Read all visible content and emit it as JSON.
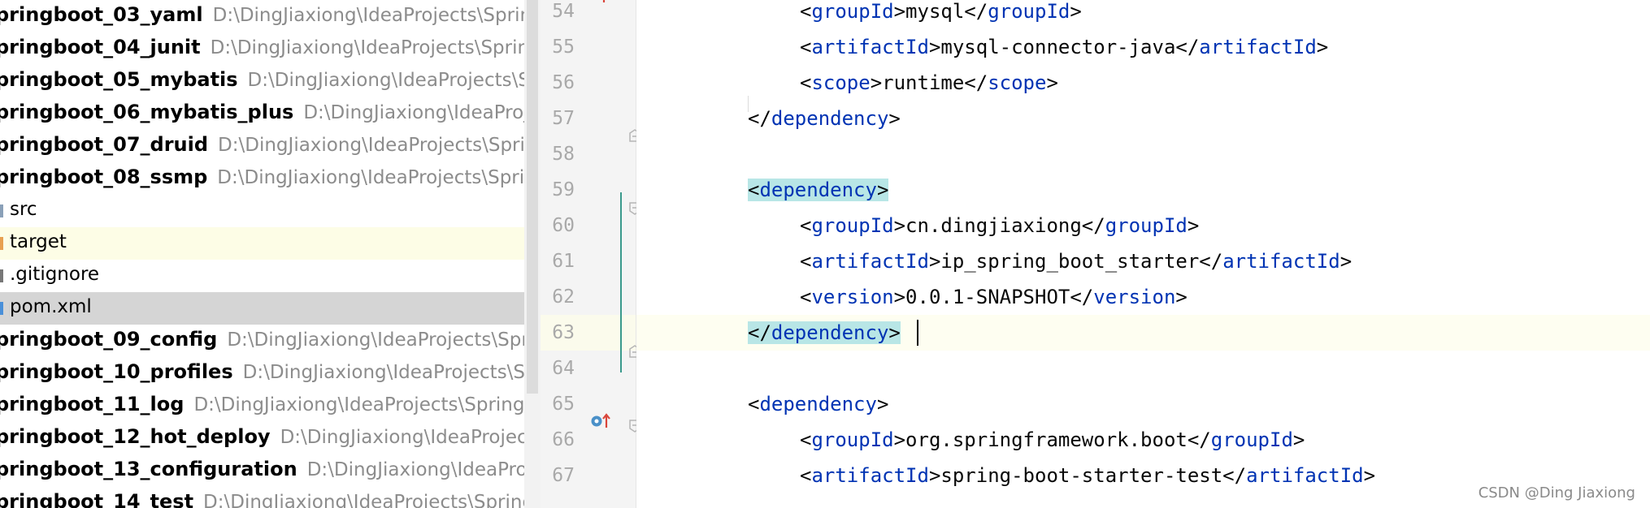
{
  "project_tree": {
    "items": [
      {
        "type": "module",
        "name": "pringboot_03_yaml",
        "path": "D:\\DingJiaxiong\\IdeaProjects\\SpringBo"
      },
      {
        "type": "module",
        "name": "pringboot_04_junit",
        "path": "D:\\DingJiaxiong\\IdeaProjects\\SpringBo"
      },
      {
        "type": "module",
        "name": "pringboot_05_mybatis",
        "path": "D:\\DingJiaxiong\\IdeaProjects\\Sprin"
      },
      {
        "type": "module",
        "name": "pringboot_06_mybatis_plus",
        "path": "D:\\DingJiaxiong\\IdeaProjects"
      },
      {
        "type": "module",
        "name": "pringboot_07_druid",
        "path": "D:\\DingJiaxiong\\IdeaProjects\\SpringB"
      },
      {
        "type": "module",
        "name": "pringboot_08_ssmp",
        "path": "D:\\DingJiaxiong\\IdeaProjects\\SpringB"
      },
      {
        "type": "folder",
        "name": "src",
        "icon": "folder-icon"
      },
      {
        "type": "folder",
        "name": "target",
        "icon": "folder-icon"
      },
      {
        "type": "file",
        "name": ".gitignore",
        "icon": "file-icon"
      },
      {
        "type": "file",
        "name": "pom.xml",
        "icon": "maven-file-icon"
      },
      {
        "type": "module",
        "name": "pringboot_09_config",
        "path": "D:\\DingJiaxiong\\IdeaProjects\\Spring"
      },
      {
        "type": "module",
        "name": "pringboot_10_profiles",
        "path": "D:\\DingJiaxiong\\IdeaProjects\\Sprin"
      },
      {
        "type": "module",
        "name": "pringboot_11_log",
        "path": "D:\\DingJiaxiong\\IdeaProjects\\SpringBo"
      },
      {
        "type": "module",
        "name": "pringboot_12_hot_deploy",
        "path": "D:\\DingJiaxiong\\IdeaProjects\\S"
      },
      {
        "type": "module",
        "name": "pringboot_13_configuration",
        "path": "D:\\DingJiaxiong\\IdeaProjects"
      },
      {
        "type": "module",
        "name": "pringboot_14_test",
        "path": "D:\\DingJiaxiong\\IdeaProjects\\SpringBo"
      }
    ]
  },
  "editor": {
    "lines": [
      {
        "n": "54",
        "indent": 2,
        "parts": [
          [
            "p",
            "<"
          ],
          [
            "t",
            "groupId"
          ],
          [
            "p",
            ">mysql</"
          ],
          [
            "t",
            "groupId"
          ],
          [
            "p",
            ">"
          ]
        ]
      },
      {
        "n": "55",
        "indent": 2,
        "parts": [
          [
            "p",
            "<"
          ],
          [
            "t",
            "artifactId"
          ],
          [
            "p",
            ">mysql-connector-java</"
          ],
          [
            "t",
            "artifactId"
          ],
          [
            "p",
            ">"
          ]
        ]
      },
      {
        "n": "56",
        "indent": 2,
        "parts": [
          [
            "p",
            "<"
          ],
          [
            "t",
            "scope"
          ],
          [
            "p",
            ">runtime</"
          ],
          [
            "t",
            "scope"
          ],
          [
            "p",
            ">"
          ]
        ]
      },
      {
        "n": "57",
        "indent": 1,
        "parts": [
          [
            "p",
            "</"
          ],
          [
            "t",
            "dependency"
          ],
          [
            "p",
            ">"
          ]
        ]
      },
      {
        "n": "58",
        "indent": 0,
        "parts": []
      },
      {
        "n": "59",
        "indent": 1,
        "parts": [
          [
            "h",
            "<"
          ],
          [
            "th",
            "dependency"
          ],
          [
            "h",
            ">"
          ]
        ]
      },
      {
        "n": "60",
        "indent": 2,
        "parts": [
          [
            "p",
            "<"
          ],
          [
            "t",
            "groupId"
          ],
          [
            "p",
            ">cn.dingjiaxiong</"
          ],
          [
            "t",
            "groupId"
          ],
          [
            "p",
            ">"
          ]
        ]
      },
      {
        "n": "61",
        "indent": 2,
        "parts": [
          [
            "p",
            "<"
          ],
          [
            "t",
            "artifactId"
          ],
          [
            "p",
            ">ip_spring_boot_starter</"
          ],
          [
            "t",
            "artifactId"
          ],
          [
            "p",
            ">"
          ]
        ]
      },
      {
        "n": "62",
        "indent": 2,
        "parts": [
          [
            "p",
            "<"
          ],
          [
            "t",
            "version"
          ],
          [
            "p",
            ">0.0.1-SNAPSHOT</"
          ],
          [
            "t",
            "version"
          ],
          [
            "p",
            ">"
          ]
        ]
      },
      {
        "n": "63",
        "indent": 1,
        "parts": [
          [
            "h",
            "</"
          ],
          [
            "th",
            "dependency"
          ],
          [
            "h",
            ">"
          ]
        ]
      },
      {
        "n": "64",
        "indent": 0,
        "parts": []
      },
      {
        "n": "65",
        "indent": 1,
        "parts": [
          [
            "p",
            "<"
          ],
          [
            "t",
            "dependency"
          ],
          [
            "p",
            ">"
          ]
        ]
      },
      {
        "n": "66",
        "indent": 2,
        "parts": [
          [
            "p",
            "<"
          ],
          [
            "t",
            "groupId"
          ],
          [
            "p",
            ">org.springframework.boot</"
          ],
          [
            "t",
            "groupId"
          ],
          [
            "p",
            ">"
          ]
        ]
      },
      {
        "n": "67",
        "indent": 2,
        "parts": [
          [
            "p",
            "<"
          ],
          [
            "t",
            "artifactId"
          ],
          [
            "p",
            ">spring-boot-starter-test</"
          ],
          [
            "t",
            "artifactId"
          ],
          [
            "p",
            ">"
          ]
        ]
      }
    ]
  },
  "colors": {
    "tag": "#0033b3",
    "text": "#080808",
    "line_number": "#a9a9a9",
    "highlight": "#b8e6e6",
    "current_line": "#fefef1"
  },
  "watermark": "CSDN @Ding Jiaxiong"
}
